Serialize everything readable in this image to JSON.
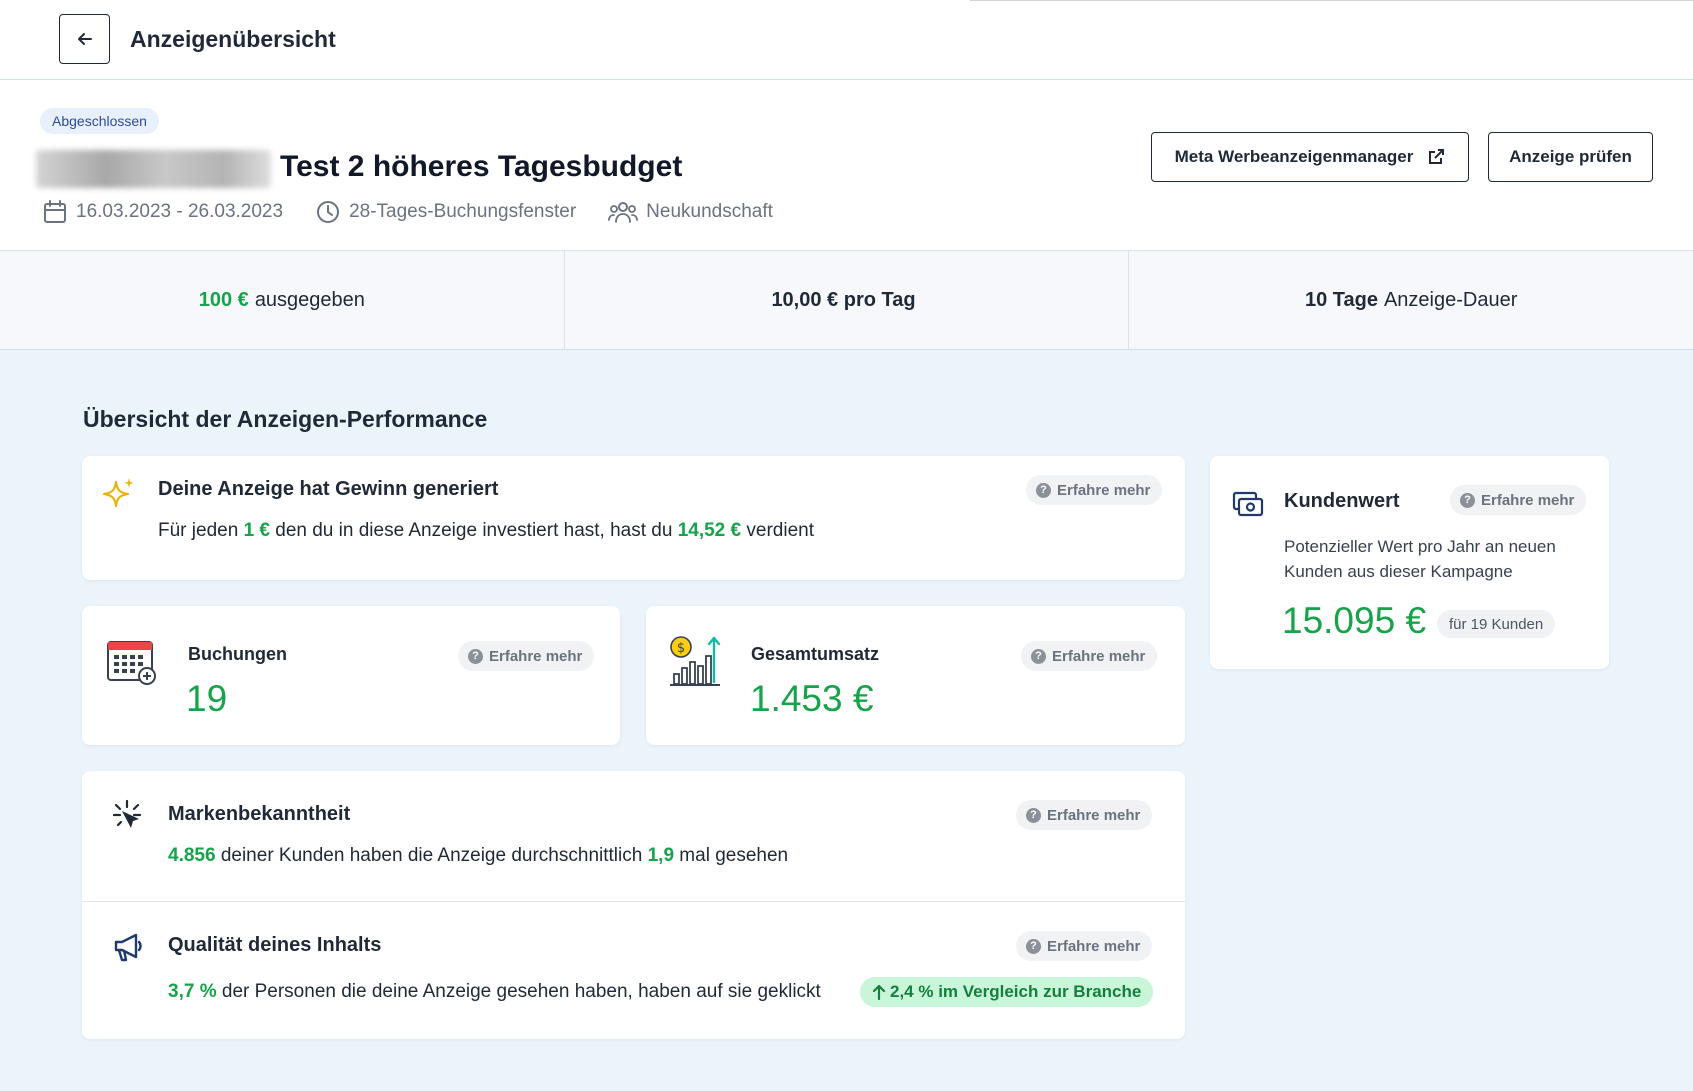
{
  "topbar": {
    "title": "Anzeigenübersicht",
    "back_icon": "arrow-left-icon"
  },
  "header": {
    "status": "Abgeschlossen",
    "title": "Test 2 höheres Tagesbudget",
    "date_range": "16.03.2023 - 26.03.2023",
    "booking_window": "28-Tages-Buchungsfenster",
    "audience": "Neukundschaft",
    "meta_button": "Meta Werbeanzeigenmanager",
    "review_button": "Anzeige prüfen"
  },
  "stats": {
    "spent_value": "100 €",
    "spent_label": "ausgegeben",
    "daily_value": "10,00 € pro Tag",
    "duration_value": "10 Tage",
    "duration_label": "Anzeige-Dauer"
  },
  "performance": {
    "section_title": "Übersicht der Anzeigen-Performance",
    "learn_more": "Erfahre mehr",
    "profit": {
      "title": "Deine Anzeige hat Gewinn generiert",
      "text_1": "Für jeden",
      "invest": "1 €",
      "text_2": "den du in diese Anzeige investiert hast, hast du",
      "earned": "14,52 €",
      "text_3": "verdient"
    },
    "bookings": {
      "title": "Buchungen",
      "value": "19"
    },
    "revenue": {
      "title": "Gesamtumsatz",
      "value": "1.453 €"
    },
    "customer_value": {
      "title": "Kundenwert",
      "description": "Potenzieller Wert pro Jahr an neuen Kunden aus dieser Kampagne",
      "value": "15.095 €",
      "customers": "für 19 Kunden"
    },
    "brand": {
      "title": "Markenbekanntheit",
      "reach": "4.856",
      "text_1": "deiner Kunden haben die Anzeige durchschnittlich",
      "frequency": "1,9",
      "text_2": "mal gesehen"
    },
    "quality": {
      "title": "Qualität deines Inhalts",
      "ctr": "3,7 %",
      "text": "der Personen die deine Anzeige gesehen haben, haben auf sie geklickt",
      "compare": "2,4 % im Vergleich zur Branche"
    }
  },
  "colors": {
    "accent_green": "#16a34a",
    "content_bg": "#ebf3fb",
    "badge_blue": "#e7f0fb"
  }
}
